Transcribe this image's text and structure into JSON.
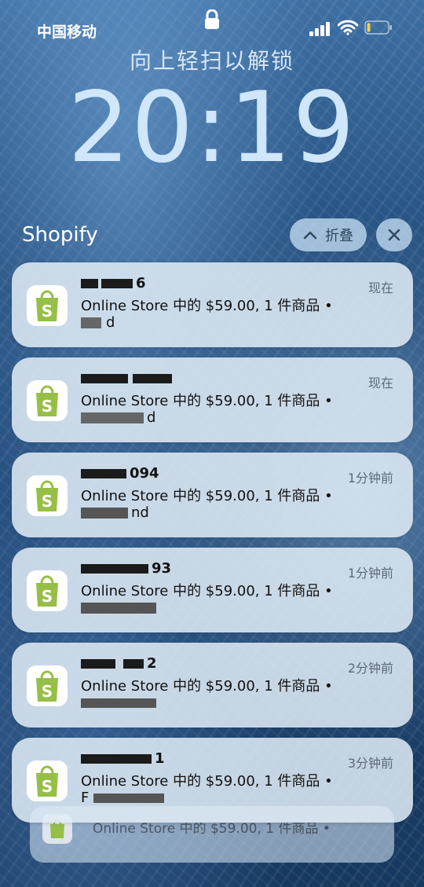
{
  "status_bar": {
    "carrier": "中国移动",
    "icons": [
      "lock-icon",
      "cellular-signal-icon",
      "wifi-icon",
      "battery-icon"
    ]
  },
  "lock_screen": {
    "unlock_hint": "向上轻扫以解锁",
    "time": "20:19"
  },
  "notification_group": {
    "app_name": "Shopify",
    "collapse_label": "折叠",
    "close_icon": "close-icon",
    "accent_color": "#95bf47",
    "notifications": [
      {
        "title": "6",
        "body": "Online Store 中的 $59.00, 1 件商品 •",
        "sub": "d",
        "time": "现在"
      },
      {
        "title": "",
        "body": "Online Store 中的 $59.00, 1 件商品 •",
        "sub": "d",
        "time": "现在"
      },
      {
        "title": "094",
        "body": "Online Store 中的 $59.00, 1 件商品 •",
        "sub": "nd",
        "time": "1分钟前"
      },
      {
        "title": "93",
        "body": "Online Store 中的 $59.00, 1 件商品 •",
        "sub": "",
        "time": "1分钟前"
      },
      {
        "title": "2",
        "body": "Online Store 中的 $59.00, 1 件商品 •",
        "sub": "",
        "time": "2分钟前"
      },
      {
        "title": "1",
        "body": "Online Store 中的 $59.00, 1 件商品 •",
        "sub": "F",
        "time": "3分钟前"
      }
    ],
    "stacked_card": {
      "body": "Online Store 中的 $59.00, 1 件商品 •"
    }
  }
}
